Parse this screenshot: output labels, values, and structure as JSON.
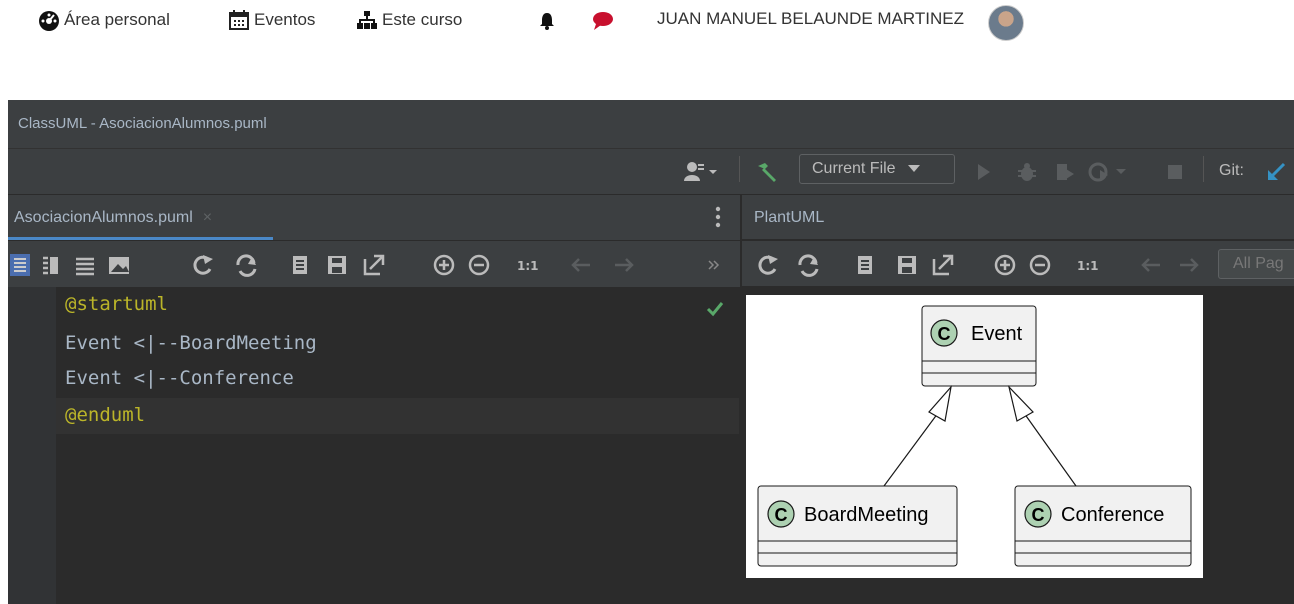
{
  "moodle_nav": {
    "dashboard_label": "Área personal",
    "events_label": "Eventos",
    "course_label": "Este curso",
    "user_name": "JUAN MANUEL BELAUNDE MARTINEZ"
  },
  "ide": {
    "window_title": "ClassUML - AsociacionAlumnos.puml",
    "run_config": "Current File",
    "git_label": "Git:",
    "editor_tab": "AsociacionAlumnos.puml",
    "tab_close": "×",
    "zoom_reset_label": "1:1",
    "code_lines": [
      "@startuml",
      "Event <|--BoardMeeting",
      "Event <|--Conference",
      "@enduml"
    ],
    "plantuml_panel_title": "PlantUML",
    "pages_placeholder": "All Pag"
  },
  "diagram": {
    "stereotype_letter": "C",
    "classes": [
      "Event",
      "BoardMeeting",
      "Conference"
    ]
  },
  "colors": {
    "accent_blue": "#4a88c7",
    "check_green": "#59a869",
    "keyword_yellow": "#bbb529",
    "class_fill": "#f1f1f1",
    "class_circle": "#add1b2"
  }
}
